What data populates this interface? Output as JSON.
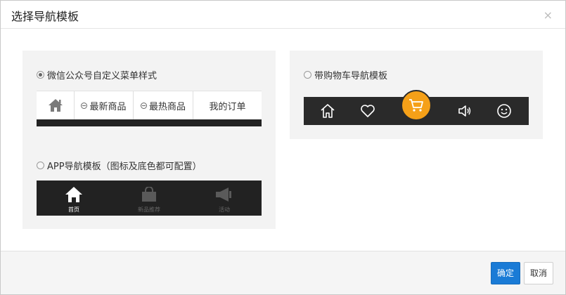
{
  "dialog": {
    "title": "选择导航模板",
    "close_glyph": "×"
  },
  "options": {
    "wechat": {
      "label": "微信公众号自定义菜单样式",
      "selected": true,
      "menu": [
        "最新商品",
        "最热商品",
        "我的订单"
      ],
      "home_icon": "home-icon"
    },
    "shop": {
      "label": "带购物车导航模板",
      "selected": false,
      "icons": [
        "home-icon",
        "heart-icon",
        "cart-icon",
        "volume-icon",
        "smile-icon"
      ],
      "accent": "#f5a018"
    },
    "app": {
      "label": "APP导航模板（图标及底色都可配置）",
      "selected": false,
      "items": [
        {
          "label": "首页",
          "icon": "home-icon",
          "active": true
        },
        {
          "label": "新品推荐",
          "icon": "bag-icon",
          "active": false
        },
        {
          "label": "活动",
          "icon": "megaphone-icon",
          "active": false
        }
      ]
    }
  },
  "footer": {
    "ok_label": "确定",
    "cancel_label": "取消",
    "ok_color": "#1a7bd6"
  }
}
